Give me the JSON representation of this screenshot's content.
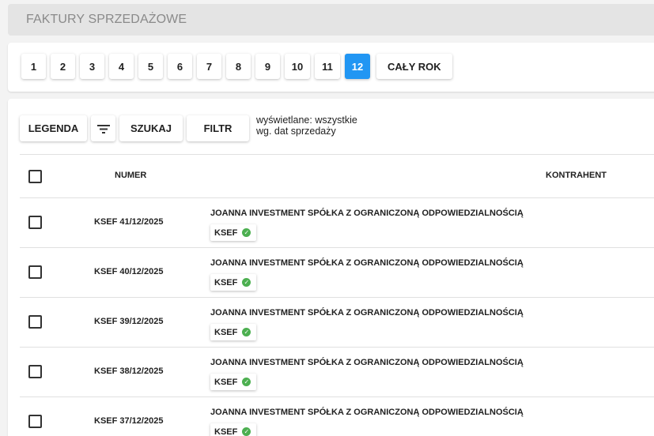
{
  "header": {
    "title": "FAKTURY SPRZEDAŻOWE"
  },
  "months": [
    "1",
    "2",
    "3",
    "4",
    "5",
    "6",
    "7",
    "8",
    "9",
    "10",
    "11",
    "12"
  ],
  "active_month": "12",
  "whole_year_label": "CAŁY ROK",
  "toolbar": {
    "legend_label": "LEGENDA",
    "filter_icon": "filter-lines-icon",
    "search_label": "SZUKAJ",
    "filter_label": "FILTR",
    "info_line1": "wyświetlane: wszystkie",
    "info_line2": "wg. dat sprzedaży"
  },
  "table": {
    "columns": {
      "number": "NUMER",
      "contractor": "KONTRAHENT"
    },
    "rows": [
      {
        "number": "KSEF 41/12/2025",
        "client": "JOANNA INVESTMENT SPÓŁKA Z OGRANICZONĄ ODPOWIEDZIALNOŚCIĄ",
        "badge": "KSEF"
      },
      {
        "number": "KSEF 40/12/2025",
        "client": "JOANNA INVESTMENT SPÓŁKA Z OGRANICZONĄ ODPOWIEDZIALNOŚCIĄ",
        "badge": "KSEF"
      },
      {
        "number": "KSEF 39/12/2025",
        "client": "JOANNA INVESTMENT SPÓŁKA Z OGRANICZONĄ ODPOWIEDZIALNOŚCIĄ",
        "badge": "KSEF"
      },
      {
        "number": "KSEF 38/12/2025",
        "client": "JOANNA INVESTMENT SPÓŁKA Z OGRANICZONĄ ODPOWIEDZIALNOŚCIĄ",
        "badge": "KSEF"
      },
      {
        "number": "KSEF 37/12/2025",
        "client": "JOANNA INVESTMENT SPÓŁKA Z OGRANICZONĄ ODPOWIEDZIALNOŚCIĄ",
        "badge": "KSEF"
      }
    ]
  },
  "colors": {
    "accent": "#2196f3",
    "ok": "#4caf50"
  }
}
